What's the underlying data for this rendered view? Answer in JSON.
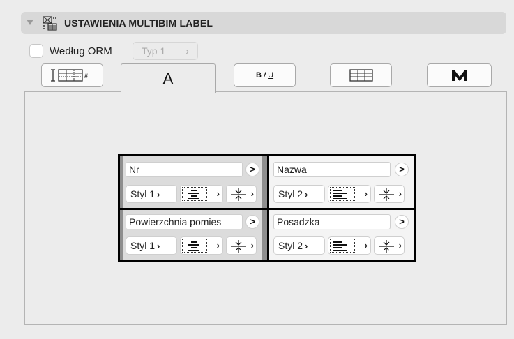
{
  "panel": {
    "title": "USTAWIENIA MULTIBIM LABEL",
    "collapse_icon": "triangle-down-icon",
    "header_icon": "label-settings-icon"
  },
  "options": {
    "by_orm_label": "Według ORM",
    "by_orm_checked": false,
    "type_value": "Typ 1",
    "type_chevron": "›"
  },
  "tabs": [
    {
      "name": "table-hash-tab",
      "icon": "table-hash-icon",
      "label": ""
    },
    {
      "name": "text-tab",
      "icon": "",
      "label": "A",
      "active": true
    },
    {
      "name": "font-style-tab",
      "icon": "",
      "label": "B / U"
    },
    {
      "name": "grid-tab",
      "icon": "grid-icon",
      "label": ""
    },
    {
      "name": "multibim-tab",
      "icon": "multibim-logo-icon",
      "label": ""
    }
  ],
  "cells": [
    {
      "field": "Nr",
      "style": "Styl 1",
      "align": "center"
    },
    {
      "field": "Nazwa",
      "style": "Styl 2",
      "align": "left"
    },
    {
      "field": "Powierzchnia pomies",
      "style": "Styl 1",
      "align": "center"
    },
    {
      "field": "Posadzka",
      "style": "Styl 2",
      "align": "left"
    }
  ],
  "chevron": "›",
  "circle_chevron": ">"
}
